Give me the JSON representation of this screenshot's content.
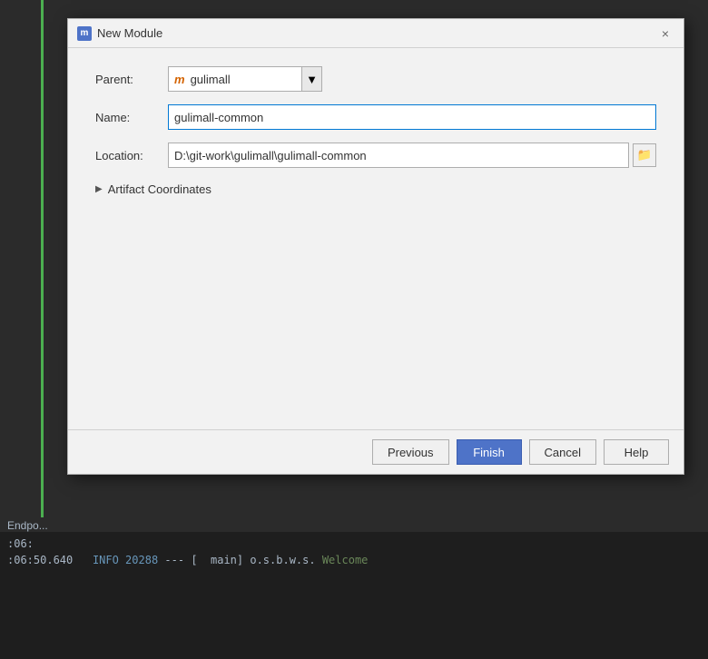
{
  "dialog": {
    "title": "New Module",
    "title_icon": "m",
    "close_label": "×",
    "fields": {
      "parent_label": "Parent:",
      "parent_value": "gulimall",
      "parent_icon": "m",
      "name_label": "Name:",
      "name_value": "gulimall-common",
      "location_label": "Location:",
      "location_value": "D:\\git-work\\gulimall\\gulimall-common"
    },
    "artifact_section": {
      "label": "Artifact Coordinates",
      "collapsed": true
    },
    "footer": {
      "previous_label": "Previous",
      "finish_label": "Finish",
      "cancel_label": "Cancel",
      "help_label": "Help"
    }
  },
  "terminal": {
    "lines": [
      {
        "text": ":06:",
        "type": "timestamp"
      },
      {
        "text": ":06:50.640  INFO 20288 --- [  main] o.s.b.w.s.Welcome",
        "type": "normal"
      }
    ],
    "endpoint_label": "Endpo..."
  },
  "colors": {
    "primary": "#4e73c8",
    "accent_green": "#4caf50",
    "parent_icon": "#d46300"
  }
}
